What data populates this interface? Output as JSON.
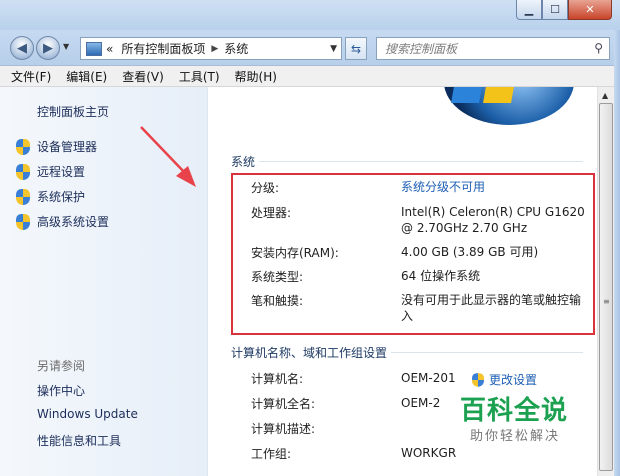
{
  "window": {
    "buttons": {
      "minimize": "▁",
      "maximize": "☐",
      "close": "✕"
    }
  },
  "addressbar": {
    "chevron": "«",
    "crumbs": [
      "所有控制面板项",
      "系统"
    ],
    "search_placeholder": "搜索控制面板"
  },
  "menu": [
    "文件(F)",
    "编辑(E)",
    "查看(V)",
    "工具(T)",
    "帮助(H)"
  ],
  "sidebar": {
    "home": "控制面板主页",
    "tasks": [
      "设备管理器",
      "远程设置",
      "系统保护",
      "高级系统设置"
    ],
    "see_also_title": "另请参阅",
    "see_also": [
      "操作中心",
      "Windows Update",
      "性能信息和工具"
    ]
  },
  "system": {
    "heading": "系统",
    "rating_label": "分级:",
    "rating_value": "系统分级不可用",
    "cpu_label": "处理器:",
    "cpu_value_line1": "Intel(R) Celeron(R) CPU G1620",
    "cpu_value_line2": "@ 2.70GHz   2.70 GHz",
    "ram_label": "安装内存(RAM):",
    "ram_value": "4.00 GB (3.89 GB 可用)",
    "type_label": "系统类型:",
    "type_value": "64 位操作系统",
    "pen_label": "笔和触摸:",
    "pen_value_line1": "没有可用于此显示器的笔或触控输",
    "pen_value_line2": "入"
  },
  "computer": {
    "heading": "计算机名称、域和工作组设置",
    "name_label": "计算机名:",
    "name_value": "OEM-201",
    "fullname_label": "计算机全名:",
    "fullname_value": "OEM-2",
    "desc_label": "计算机描述:",
    "workgroup_label": "工作组:",
    "workgroup_value": "WORKGR",
    "change_settings": "更改设置"
  },
  "watermark": {
    "logo": "百科全说",
    "sub": "助你轻松解决"
  },
  "colors": {
    "highlight_border": "#d9323b",
    "link": "#1e5fb4",
    "arrow": "#e8424a"
  }
}
